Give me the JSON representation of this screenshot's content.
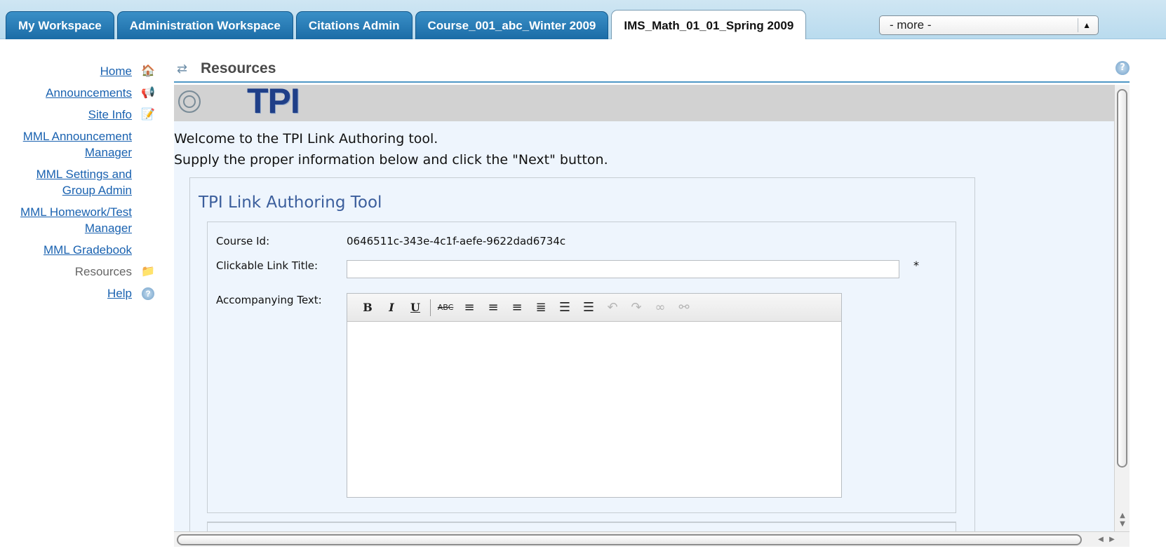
{
  "tabs": [
    {
      "label": "My Workspace"
    },
    {
      "label": "Administration Workspace"
    },
    {
      "label": "Citations Admin"
    },
    {
      "label": "Course_001_abc_Winter 2009"
    },
    {
      "label": "IMS_Math_01_01_Spring 2009"
    }
  ],
  "active_tab_index": 4,
  "more_select": {
    "value": "- more -",
    "icon": "select-arrows-icon"
  },
  "nav": {
    "items": [
      {
        "label": "Home",
        "icon": "home-icon",
        "glyph": "🏠"
      },
      {
        "label": "Announcements",
        "icon": "announcements-icon",
        "glyph": "📢"
      },
      {
        "label": "Site Info",
        "icon": "site-info-icon",
        "glyph": "📝"
      },
      {
        "label": "MML Announcement Manager",
        "icon": "",
        "glyph": ""
      },
      {
        "label": "MML Settings and Group Admin",
        "icon": "",
        "glyph": ""
      },
      {
        "label": "MML Homework/Test Manager",
        "icon": "",
        "glyph": ""
      },
      {
        "label": "MML Gradebook",
        "icon": "",
        "glyph": ""
      },
      {
        "label": "Resources",
        "icon": "folder-icon",
        "glyph": "📁"
      },
      {
        "label": "Help",
        "icon": "help-icon",
        "glyph": "?"
      }
    ],
    "current_index": 7
  },
  "portlet": {
    "title": "Resources",
    "reset_icon": "reset-arrows-icon",
    "help_icon": "help-icon"
  },
  "banner": {
    "logo_text": "TPI",
    "spiral_icon": "spiral-icon"
  },
  "welcome": {
    "line1": "Welcome to the TPI Link Authoring tool.",
    "line2": "Supply the proper information below and click the \"Next\" button."
  },
  "form": {
    "title": "TPI Link Authoring Tool",
    "course_id_label": "Course Id:",
    "course_id_value": "0646511c-343e-4c1f-aefe-9622dad6734c",
    "link_title_label": "Clickable Link Title:",
    "link_title_value": "",
    "required_mark": "*",
    "text_label": "Accompanying Text:"
  },
  "toolbar": [
    {
      "name": "bold-button",
      "glyph": "B",
      "cls": "b"
    },
    {
      "name": "italic-button",
      "glyph": "I",
      "cls": "i"
    },
    {
      "name": "underline-button",
      "glyph": "U",
      "cls": "u"
    },
    {
      "name": "strikethrough-button",
      "glyph": "ABC",
      "cls": "s"
    },
    {
      "name": "align-left-button",
      "glyph": "≡",
      "cls": "plain"
    },
    {
      "name": "align-center-button",
      "glyph": "≡",
      "cls": "plain"
    },
    {
      "name": "align-right-button",
      "glyph": "≡",
      "cls": "plain"
    },
    {
      "name": "justify-button",
      "glyph": "≣",
      "cls": "plain"
    },
    {
      "name": "bullet-list-button",
      "glyph": "☰",
      "cls": "plain"
    },
    {
      "name": "numbered-list-button",
      "glyph": "☰",
      "cls": "plain"
    },
    {
      "name": "undo-button",
      "glyph": "↶",
      "cls": "plain dim"
    },
    {
      "name": "redo-button",
      "glyph": "↷",
      "cls": "plain dim"
    },
    {
      "name": "link-button",
      "glyph": "∞",
      "cls": "plain dim"
    },
    {
      "name": "unlink-button",
      "glyph": "⚯",
      "cls": "plain dim"
    }
  ]
}
